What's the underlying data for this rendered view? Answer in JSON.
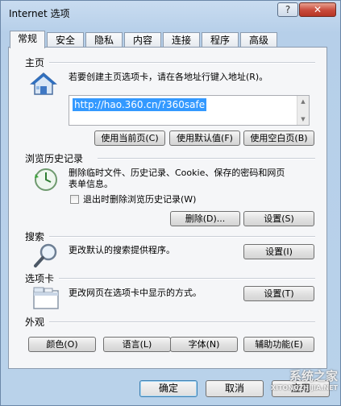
{
  "window": {
    "title": "Internet 选项",
    "help_label": "?",
    "close_label": "✕"
  },
  "tabs": [
    {
      "label": "常规",
      "active": true
    },
    {
      "label": "安全"
    },
    {
      "label": "隐私"
    },
    {
      "label": "内容"
    },
    {
      "label": "连接"
    },
    {
      "label": "程序"
    },
    {
      "label": "高级"
    }
  ],
  "home": {
    "title": "主页",
    "description": "若要创建主页选项卡，请在各地址行键入地址(R)。",
    "url": "http://hao.360.cn/?360safe",
    "buttons": {
      "use_current": "使用当前页(C)",
      "use_default": "使用默认值(F)",
      "use_blank": "使用空白页(B)"
    }
  },
  "history": {
    "title": "浏览历史记录",
    "description_line1": "删除临时文件、历史记录、Cookie、保存的密码和网页",
    "description_line2": "表单信息。",
    "checkbox_label": "退出时删除浏览历史记录(W)",
    "checkbox_checked": false,
    "buttons": {
      "delete": "删除(D)...",
      "settings": "设置(S)"
    }
  },
  "search": {
    "title": "搜索",
    "description": "更改默认的搜索提供程序。",
    "buttons": {
      "settings": "设置(I)"
    }
  },
  "tabs_section": {
    "title": "选项卡",
    "description": "更改网页在选项卡中显示的方式。",
    "buttons": {
      "settings": "设置(T)"
    }
  },
  "appearance": {
    "title": "外观",
    "buttons": {
      "colors": "颜色(O)",
      "languages": "语言(L)",
      "fonts": "字体(N)",
      "accessibility": "辅助功能(E)"
    }
  },
  "footer": {
    "ok": "确定",
    "cancel": "取消",
    "apply": "应用"
  },
  "watermark": {
    "line1": "系统之家",
    "line2": "XITONGZHIJIA.NET"
  },
  "icons": {
    "home": "house-icon",
    "history": "clock-history-icon",
    "search": "magnifier-icon",
    "tabs": "tabbed-window-icon"
  }
}
